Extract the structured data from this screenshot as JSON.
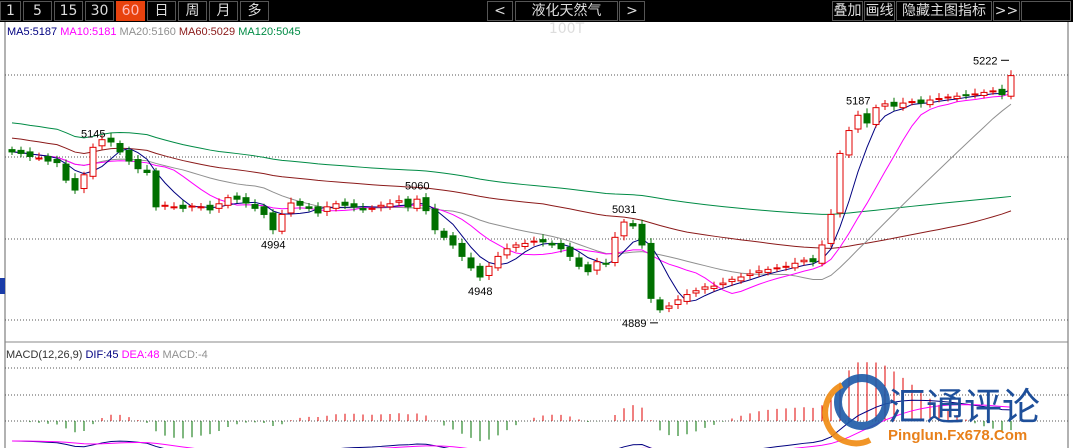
{
  "toolbar": {
    "periods": [
      "1",
      "5",
      "15",
      "30",
      "60",
      "日",
      "周",
      "月",
      "多"
    ],
    "active_period": "60",
    "prev": "<",
    "symbol": "液化天然气100T",
    "next": ">",
    "overlay": "叠加",
    "draw_line": "画线",
    "hide_indicators": "隐藏主图指标",
    "more": ">>"
  },
  "ma_legend": {
    "ma5": "MA5:5187",
    "ma10": "MA10:5181",
    "ma20": "MA20:5160",
    "ma60": "MA60:5029",
    "ma120": "MA120:5045"
  },
  "macd_legend": {
    "title": "MACD(12,26,9)",
    "dif": "DIF:45",
    "dea": "DEA:48",
    "macd": "MACD:-4"
  },
  "colors": {
    "up": "#e00000",
    "down": "#007000",
    "ma5": "#000080",
    "ma10": "#ff00ff",
    "ma20": "#909090",
    "ma60": "#8b1a1a",
    "ma120": "#008b45"
  },
  "annotations": [
    {
      "index": 9,
      "text": "5145"
    },
    {
      "index": 29,
      "text": "4994"
    },
    {
      "index": 45,
      "text": "5060"
    },
    {
      "index": 52,
      "text": "4948"
    },
    {
      "index": 68,
      "text": "5031"
    },
    {
      "index": 72,
      "text": "4889"
    },
    {
      "index": 94,
      "text": "5187"
    },
    {
      "index": 111,
      "text": "5222"
    }
  ],
  "watermark": {
    "cn": "汇通评论",
    "en": "Pinglun.Fx678.Com"
  },
  "chart_data": {
    "type": "candlestick",
    "closes": [
      5112,
      5110,
      5106,
      5104,
      5100,
      5098,
      5075,
      5062,
      5082,
      5118,
      5128,
      5125,
      5112,
      5100,
      5090,
      5085,
      5040,
      5042,
      5040,
      5038,
      5041,
      5040,
      5036,
      5044,
      5052,
      5050,
      5045,
      5038,
      5030,
      5010,
      5030,
      5045,
      5042,
      5038,
      5032,
      5040,
      5044,
      5042,
      5040,
      5036,
      5038,
      5042,
      5044,
      5048,
      5040,
      5050,
      5035,
      5010,
      5000,
      4990,
      4975,
      4960,
      4948,
      4962,
      4975,
      4985,
      4990,
      4992,
      4995,
      4994,
      4990,
      4985,
      4975,
      4962,
      4955,
      4968,
      4965,
      5000,
      5020,
      5015,
      4990,
      4920,
      4905,
      4910,
      4918,
      4925,
      4930,
      4935,
      4936,
      4940,
      4945,
      4948,
      4952,
      4956,
      4958,
      4960,
      4962,
      4966,
      4970,
      4968,
      4990,
      5030,
      5110,
      5140,
      5160,
      5150,
      5170,
      5175,
      5172,
      5176,
      5178,
      5176,
      5180,
      5182,
      5184,
      5185,
      5186,
      5188,
      5190,
      5192,
      5187,
      5212
    ]
  }
}
